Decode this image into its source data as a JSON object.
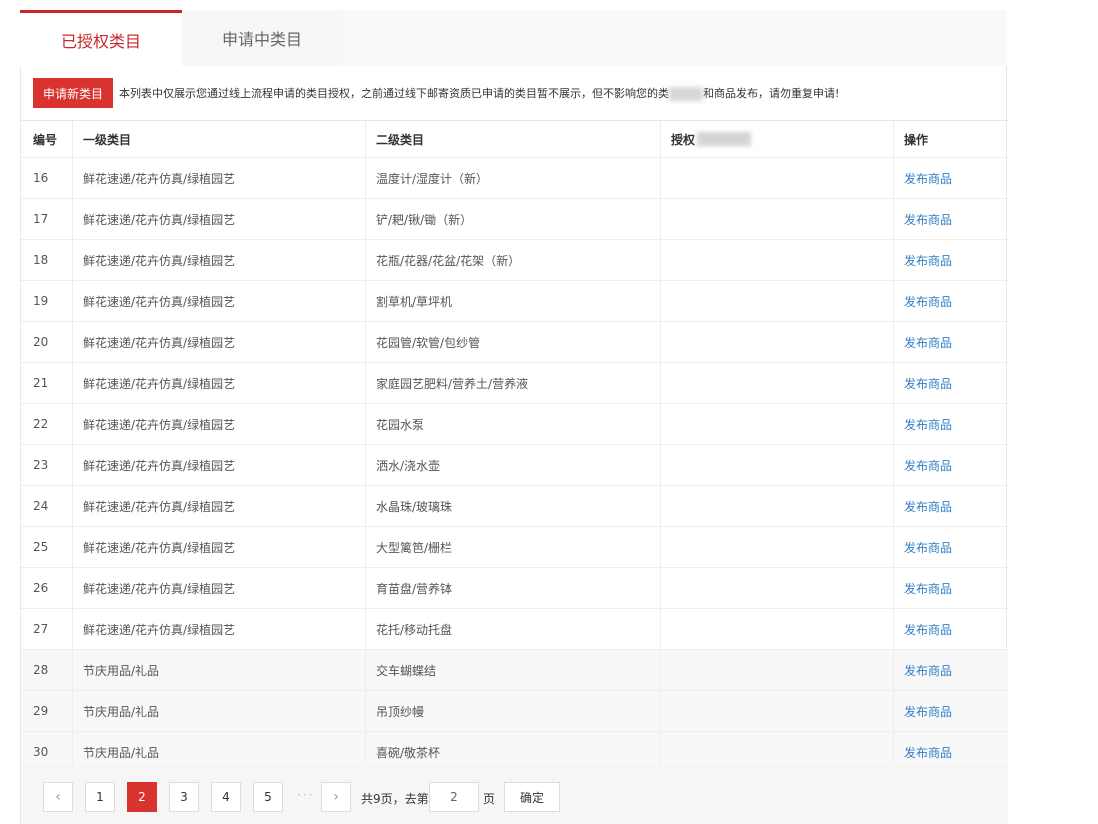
{
  "tabs": [
    {
      "label": "已授权类目"
    },
    {
      "label": "申请中类目"
    }
  ],
  "notice": {
    "button_label": "申请新类目",
    "text_before": "本列表中仅展示您通过线上流程申请的类目授权，之前通过线下邮寄资质已申请的类目暂不展示，但不影响您的类",
    "text_after": "和商品发布，请勿重复申请!"
  },
  "table": {
    "headers": {
      "id": "编号",
      "level1": "一级类目",
      "level2": "二级类目",
      "auth": "授权",
      "action": "操作"
    },
    "rows": [
      {
        "id": "16",
        "level1": "鲜花速递/花卉仿真/绿植园艺",
        "level2": "温度计/湿度计（新）",
        "action": "发布商品"
      },
      {
        "id": "17",
        "level1": "鲜花速递/花卉仿真/绿植园艺",
        "level2": "铲/耙/锹/锄（新）",
        "action": "发布商品"
      },
      {
        "id": "18",
        "level1": "鲜花速递/花卉仿真/绿植园艺",
        "level2": "花瓶/花器/花盆/花架（新）",
        "action": "发布商品"
      },
      {
        "id": "19",
        "level1": "鲜花速递/花卉仿真/绿植园艺",
        "level2": "割草机/草坪机",
        "action": "发布商品"
      },
      {
        "id": "20",
        "level1": "鲜花速递/花卉仿真/绿植园艺",
        "level2": "花园管/软管/包纱管",
        "action": "发布商品"
      },
      {
        "id": "21",
        "level1": "鲜花速递/花卉仿真/绿植园艺",
        "level2": "家庭园艺肥料/营养土/营养液",
        "action": "发布商品"
      },
      {
        "id": "22",
        "level1": "鲜花速递/花卉仿真/绿植园艺",
        "level2": "花园水泵",
        "action": "发布商品"
      },
      {
        "id": "23",
        "level1": "鲜花速递/花卉仿真/绿植园艺",
        "level2": "洒水/浇水壶",
        "action": "发布商品"
      },
      {
        "id": "24",
        "level1": "鲜花速递/花卉仿真/绿植园艺",
        "level2": "水晶珠/玻璃珠",
        "action": "发布商品"
      },
      {
        "id": "25",
        "level1": "鲜花速递/花卉仿真/绿植园艺",
        "level2": "大型篱笆/栅栏",
        "action": "发布商品"
      },
      {
        "id": "26",
        "level1": "鲜花速递/花卉仿真/绿植园艺",
        "level2": "育苗盘/营养钵",
        "action": "发布商品"
      },
      {
        "id": "27",
        "level1": "鲜花速递/花卉仿真/绿植园艺",
        "level2": "花托/移动托盘",
        "action": "发布商品"
      },
      {
        "id": "28",
        "level1": "节庆用品/礼品",
        "level2": "交车蝴蝶结",
        "action": "发布商品"
      },
      {
        "id": "29",
        "level1": "节庆用品/礼品",
        "level2": "吊顶纱幔",
        "action": "发布商品"
      },
      {
        "id": "30",
        "level1": "节庆用品/礼品",
        "level2": "喜碗/敬茶杯",
        "action": "发布商品"
      }
    ]
  },
  "pagination": {
    "prev": "‹",
    "next": "›",
    "pages": [
      "1",
      "2",
      "3",
      "4",
      "5"
    ],
    "current_page": "2",
    "ellipsis": "···",
    "total_prefix": "共9页，去第",
    "goto_value": "2",
    "page_suffix": "页",
    "confirm_label": "确定"
  },
  "colors": {
    "accent": "#d9332f",
    "link": "#2f7fc7",
    "tab_active": "#c8282b"
  }
}
